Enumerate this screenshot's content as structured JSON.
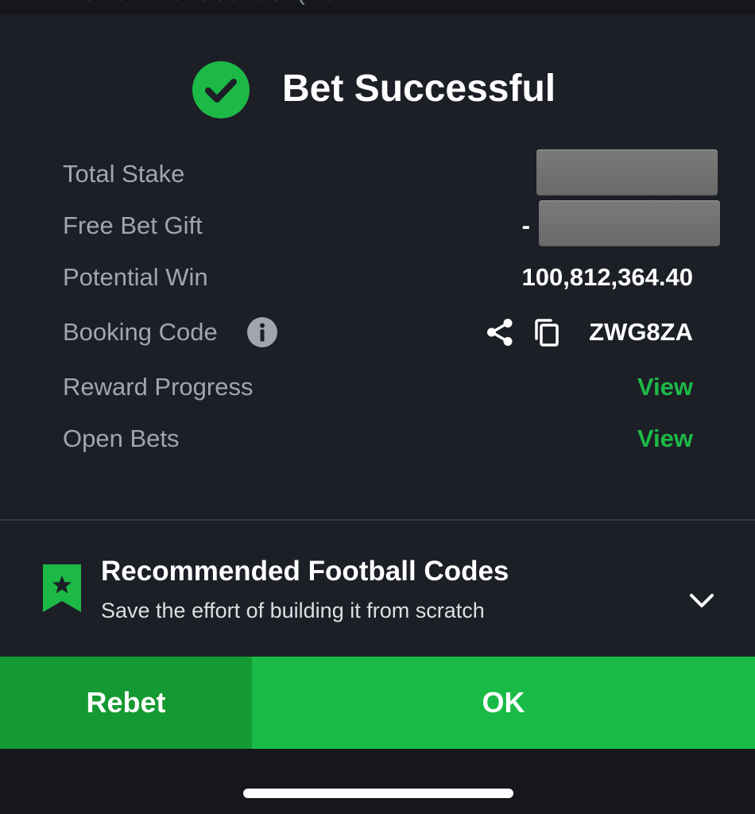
{
  "background": {
    "partial_text": "Romania Over/Under (incl."
  },
  "header": {
    "title": "Bet Successful",
    "icon": "check-circle-icon"
  },
  "details": {
    "total_stake": {
      "label": "Total Stake",
      "value_masked": true
    },
    "free_bet_gift": {
      "label": "Free Bet Gift",
      "prefix": "-",
      "value_masked": true
    },
    "potential_win": {
      "label": "Potential Win",
      "value": "100,812,364.40"
    },
    "booking_code": {
      "label": "Booking Code",
      "value": "ZWG8ZA"
    },
    "reward_progress": {
      "label": "Reward Progress",
      "action": "View"
    },
    "open_bets": {
      "label": "Open Bets",
      "action": "View"
    }
  },
  "recommended": {
    "title": "Recommended Football Codes",
    "subtitle": "Save the effort of building it from scratch",
    "icon": "bookmark-star-icon"
  },
  "actions": {
    "rebet_label": "Rebet",
    "ok_label": "OK"
  },
  "colors": {
    "accent_green": "#1db947",
    "rebet_green": "#159a33",
    "ok_green": "#19bb46",
    "sheet_background": "#1c1f26",
    "label_gray": "#a1a6ae"
  }
}
